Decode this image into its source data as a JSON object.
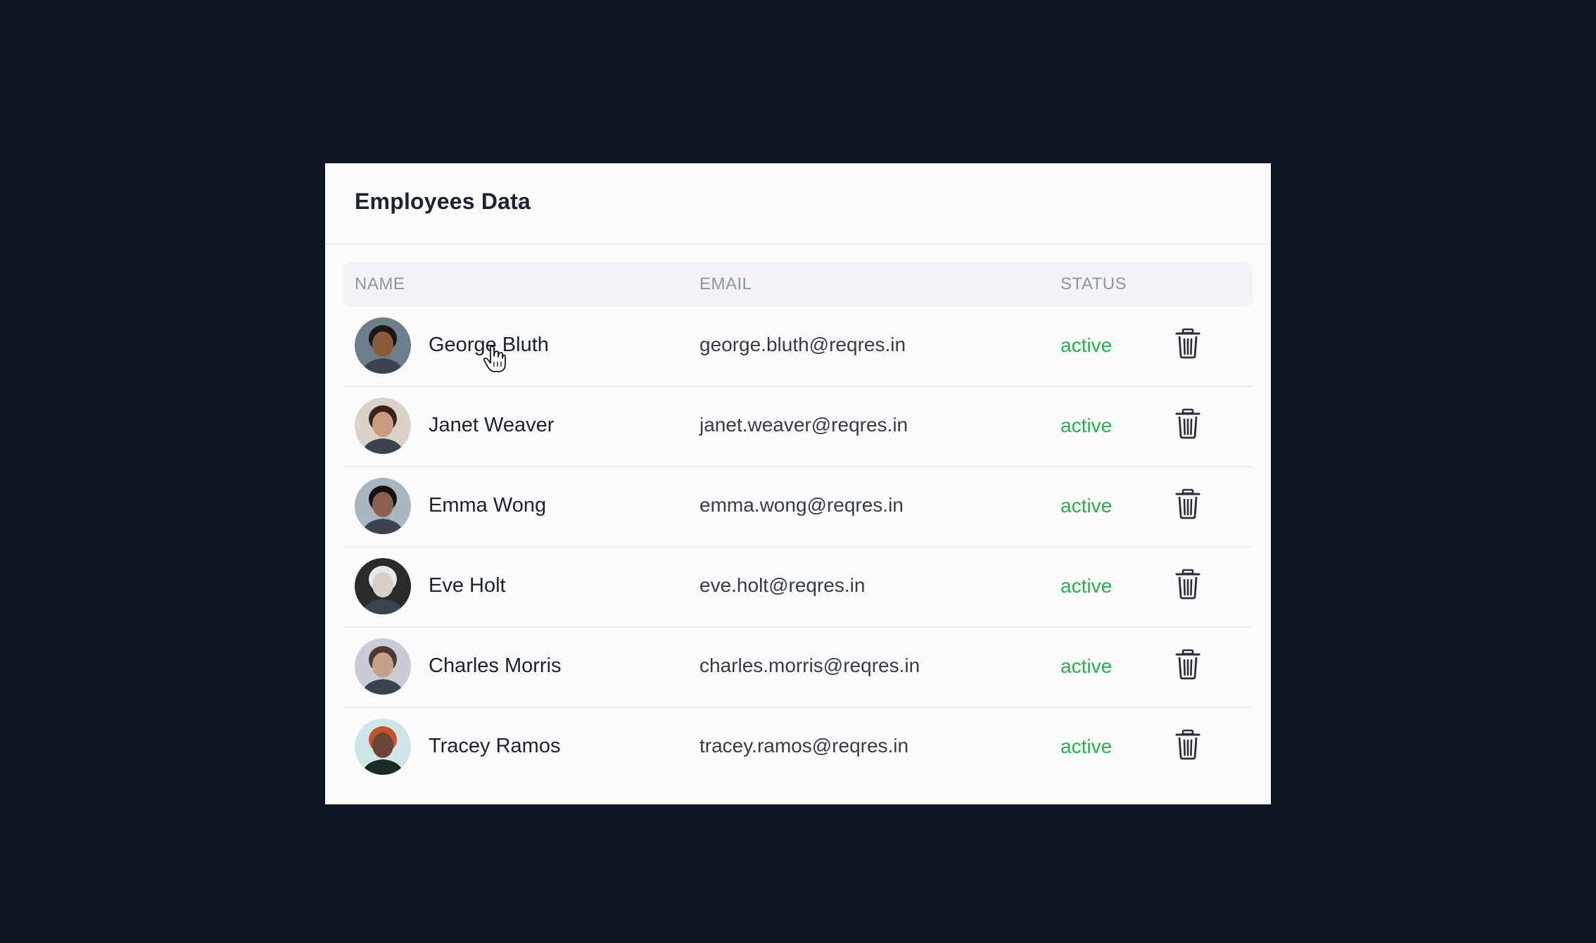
{
  "card": {
    "title": "Employees Data"
  },
  "table": {
    "columns": {
      "name": "NAME",
      "email": "EMAIL",
      "status": "STATUS"
    },
    "rows": [
      {
        "name": "George Bluth",
        "email": "george.bluth@reqres.in",
        "status": "active",
        "avatar_bg": "#6b7f8c",
        "skin": "#8a5a3c",
        "hair": "#1d1714"
      },
      {
        "name": "Janet Weaver",
        "email": "janet.weaver@reqres.in",
        "status": "active",
        "avatar_bg": "#d8d2c8",
        "skin": "#c99a80",
        "hair": "#3a2418"
      },
      {
        "name": "Emma Wong",
        "email": "emma.wong@reqres.in",
        "status": "active",
        "avatar_bg": "#a9b6c0",
        "skin": "#8c6050",
        "hair": "#151212"
      },
      {
        "name": "Eve Holt",
        "email": "eve.holt@reqres.in",
        "status": "active",
        "avatar_bg": "#2b2b2b",
        "skin": "#d8d0c8",
        "hair": "#e8e8e8"
      },
      {
        "name": "Charles Morris",
        "email": "charles.morris@reqres.in",
        "status": "active",
        "avatar_bg": "#c9ccd6",
        "skin": "#c5a08a",
        "hair": "#4a3a30"
      },
      {
        "name": "Tracey Ramos",
        "email": "tracey.ramos@reqres.in",
        "status": "active",
        "avatar_bg": "#cfe6e8",
        "skin": "#6b4636",
        "hair": "#c7502e"
      }
    ]
  },
  "colors": {
    "background": "#0f1423",
    "card": "#fbfbfb",
    "status_active": "#22b24c",
    "header_text": "#8e94a1"
  },
  "icons": {
    "delete": "trash-icon",
    "cursor": "hand-pointer-icon"
  }
}
